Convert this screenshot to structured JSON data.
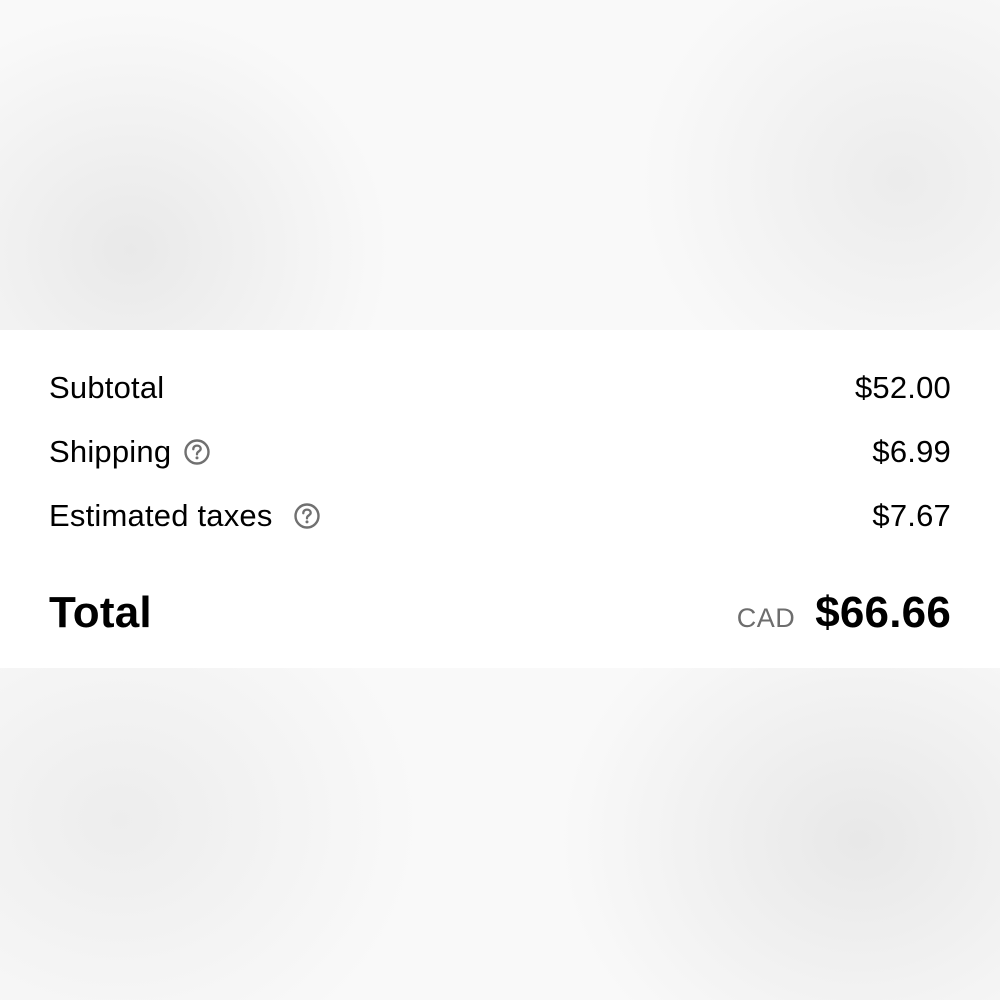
{
  "order_summary": {
    "subtotal": {
      "label": "Subtotal",
      "value": "$52.00"
    },
    "shipping": {
      "label": "Shipping",
      "value": "$6.99",
      "icon": "help-circle-icon"
    },
    "taxes": {
      "label": "Estimated taxes",
      "value": "$7.67",
      "icon": "help-circle-icon"
    },
    "total": {
      "label": "Total",
      "currency": "CAD",
      "value": "$66.66"
    }
  },
  "colors": {
    "text": "#000000",
    "muted": "#6d6d6d",
    "icon": "#707070",
    "panel": "#ffffff",
    "background": "#f9f9f9"
  }
}
